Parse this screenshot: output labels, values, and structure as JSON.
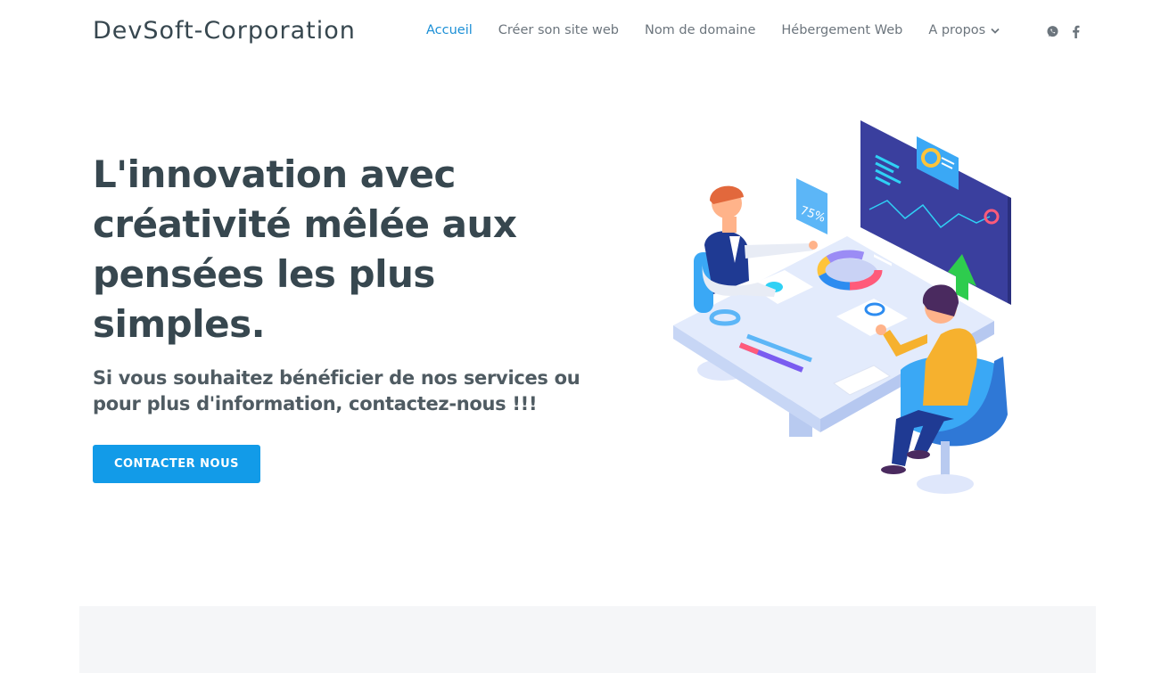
{
  "header": {
    "logo": "DevSoft-Corporation",
    "nav": [
      {
        "label": "Accueil",
        "active": true
      },
      {
        "label": "Créer son site web",
        "active": false
      },
      {
        "label": "Nom de domaine",
        "active": false
      },
      {
        "label": "Hébergement Web",
        "active": false
      },
      {
        "label": "A propos",
        "active": false,
        "dropdown": true
      }
    ],
    "social": [
      "whatsapp-icon",
      "facebook-icon"
    ]
  },
  "hero": {
    "title": "L'innovation avec créativité mêlée aux pensées les plus simples.",
    "subtitle": "Si vous souhaitez bénéficier de nos services ou pour plus d'information, contactez-nous !!!",
    "cta_label": "CONTACTER NOUS",
    "illustration": {
      "badge_text": "75%"
    }
  },
  "colors": {
    "accent": "#129be8",
    "nav_active": "#1b8fd6",
    "text_dark": "#37474f",
    "section_bg": "#f5f6f8"
  }
}
